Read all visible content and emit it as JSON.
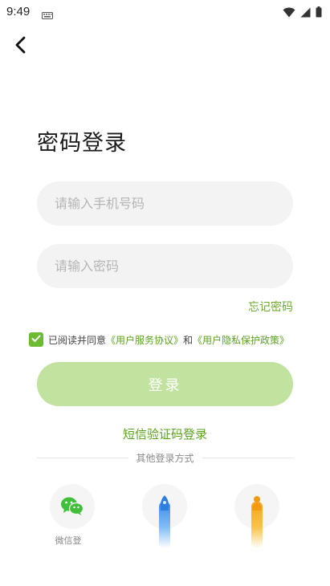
{
  "status_bar": {
    "time": "9:49"
  },
  "header": {
    "back_icon": "chevron-left-icon"
  },
  "title": "密码登录",
  "form": {
    "phone_placeholder": "请输入手机号码",
    "phone_value": "",
    "password_placeholder": "请输入密码",
    "password_value": "",
    "forgot_password": "忘记密码"
  },
  "agreement": {
    "checked": true,
    "prefix": "已阅读并同意",
    "service_link": "《用户服务协议》",
    "conjunction": "和",
    "privacy_link": "《用户隐私保护政策》"
  },
  "login_button_label": "登录",
  "sms_login_label": "短信验证码登录",
  "other_methods": {
    "heading": "其他登录方式",
    "items": [
      {
        "icon": "wechat-icon",
        "label": "微信登"
      },
      {
        "icon": "blue-rocket-icon"
      },
      {
        "icon": "orange-rocket-icon"
      }
    ]
  },
  "colors": {
    "accent_green": "#6aaa2c",
    "checkbox_green": "#6dbb32",
    "button_disabled_green": "#c2e2a0",
    "input_background": "#f3f3f3"
  }
}
